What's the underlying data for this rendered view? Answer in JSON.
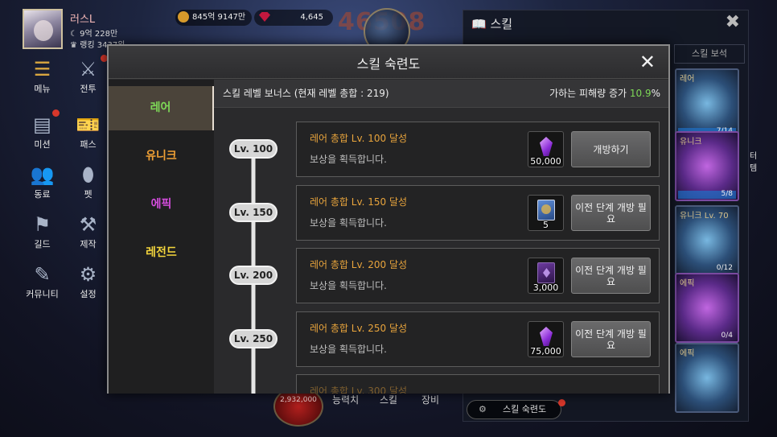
{
  "player": {
    "name": "러스L",
    "power": "9억 228만",
    "rank": "랭킹 3437위",
    "gold": "845억 9147만",
    "ruby": "4,645"
  },
  "battle": {
    "damage_text": "46508",
    "hp_orb": "2,932,000"
  },
  "side_menu": [
    {
      "label": "메뉴"
    },
    {
      "label": "전투"
    },
    {
      "label": "미션"
    },
    {
      "label": "패스"
    },
    {
      "label": "동료"
    },
    {
      "label": "펫"
    },
    {
      "label": "길드"
    },
    {
      "label": "제작"
    },
    {
      "label": "커뮤니티"
    },
    {
      "label": "설정"
    }
  ],
  "right_panel": {
    "title": "스킬",
    "tab_label": "스킬 보석",
    "cards": [
      {
        "label": "레어",
        "count": "7/14"
      },
      {
        "label": "유니크",
        "count": "5/8"
      },
      {
        "label": "유니크 Lv. 70",
        "count": "0/12"
      },
      {
        "label": "에픽",
        "count": "0/4"
      },
      {
        "label": "에픽",
        "count": ""
      }
    ],
    "side_label": "터템"
  },
  "bottom_nav": {
    "stat": "능력치",
    "skill": "스킬",
    "equip": "장비",
    "mastery_button": "스킬 숙련도"
  },
  "modal": {
    "title": "스킬 숙련도",
    "close_symbol": "✕",
    "tabs": [
      {
        "label": "레어",
        "color": "#7ed957",
        "active": true
      },
      {
        "label": "유니크",
        "color": "#f0a035",
        "active": false
      },
      {
        "label": "에픽",
        "color": "#d54dde",
        "active": false
      },
      {
        "label": "레전드",
        "color": "#f2d43c",
        "active": false
      }
    ],
    "bonus_label": "스킬 레벨 보너스 (현재 레벨 총합 : 219)",
    "damage_label": "가하는 피해량 증가",
    "damage_value": "10.9",
    "damage_unit": "%",
    "milestones": [
      {
        "level": "Lv. 100",
        "title": "레어 총합 Lv. 100 달성",
        "desc": "보상을 획득합니다.",
        "reward_icon": "purple-gem-icon",
        "reward_qty": "50,000",
        "button": "개방하기"
      },
      {
        "level": "Lv. 150",
        "title": "레어 총합 Lv. 150 달성",
        "desc": "보상을 획득합니다.",
        "reward_icon": "skill-book-icon",
        "reward_qty": "5",
        "button": "이전 단계 개방 필요"
      },
      {
        "level": "Lv. 200",
        "title": "레어 총합 Lv. 200 달성",
        "desc": "보상을 획득합니다.",
        "reward_icon": "magic-book-icon",
        "reward_qty": "3,000",
        "button": "이전 단계 개방 필요"
      },
      {
        "level": "Lv. 250",
        "title": "레어 총합 Lv. 250 달성",
        "desc": "보상을 획득합니다.",
        "reward_icon": "purple-gem-icon",
        "reward_qty": "75,000",
        "button": "이전 단계 개방 필요"
      },
      {
        "level": "",
        "title": "레어 총합 Lv. 300 달성",
        "desc": "",
        "reward_icon": "",
        "reward_qty": "",
        "button": ""
      }
    ]
  }
}
